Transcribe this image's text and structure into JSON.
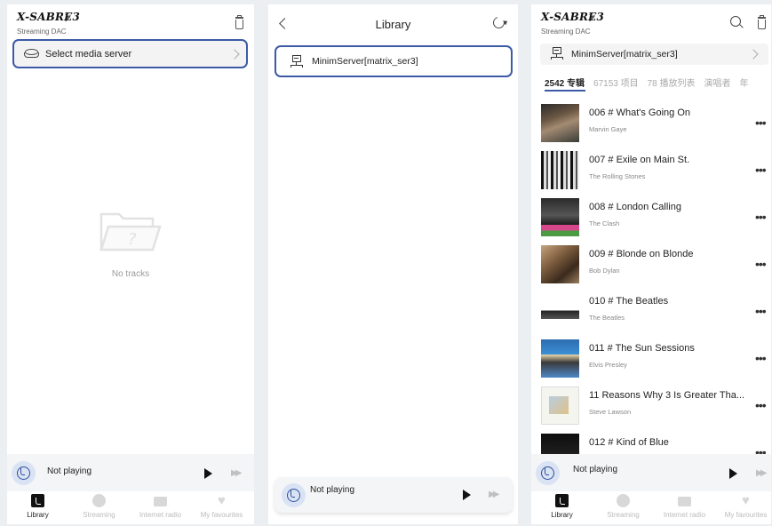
{
  "colors": {
    "accent": "#3c5aa6",
    "inactive": "#bbbbbb"
  },
  "screen1": {
    "brand": "X-SABRE3",
    "subtitle": "Streaming DAC",
    "select_server_label": "Select media server",
    "empty_text": "No tracks",
    "icons": {
      "device": "chevron-right-icon",
      "trash": "trash-icon",
      "server": "disk-drive-icon",
      "empty": "empty-folder-icon"
    }
  },
  "screen2": {
    "title": "Library",
    "server_name": "MinimServer[matrix_ser3]",
    "icons": {
      "back": "back-chevron-icon",
      "refresh": "refresh-icon",
      "server": "server-icon"
    }
  },
  "screen3": {
    "brand": "X-SABRE3",
    "subtitle": "Streaming DAC",
    "server_name": "MinimServer[matrix_ser3]",
    "category_tabs": [
      "2542 专辑",
      "67153 项目",
      "78 播放列表",
      "演唱者",
      "年"
    ],
    "albums": [
      {
        "title": "006 # What's Going On",
        "artist": "Marvin Gaye"
      },
      {
        "title": "007 # Exile on Main St.",
        "artist": "The Rolling Stones"
      },
      {
        "title": "008 # London Calling",
        "artist": "The Clash"
      },
      {
        "title": "009 # Blonde on Blonde",
        "artist": "Bob Dylan"
      },
      {
        "title": "010 # The Beatles",
        "artist": "The Beatles"
      },
      {
        "title": "011 # The Sun Sessions",
        "artist": "Elvis Presley"
      },
      {
        "title": "11 Reasons Why 3 Is Greater Tha...",
        "artist": "Steve Lawson"
      },
      {
        "title": "012 # Kind of Blue",
        "artist": ""
      }
    ],
    "more_glyph": "•••"
  },
  "player": {
    "status": "Not playing",
    "icons": {
      "disc": "music-disc-icon",
      "play": "play-icon",
      "next": "fast-forward-icon"
    },
    "next_glyph": "▶▶"
  },
  "tabs": [
    {
      "label": "Library",
      "icon": "library-icon",
      "active": true
    },
    {
      "label": "Streaming",
      "icon": "streaming-icon",
      "active": false
    },
    {
      "label": "Internet radio",
      "icon": "radio-icon",
      "active": false
    },
    {
      "label": "My favourites",
      "icon": "heart-icon",
      "active": false
    }
  ]
}
